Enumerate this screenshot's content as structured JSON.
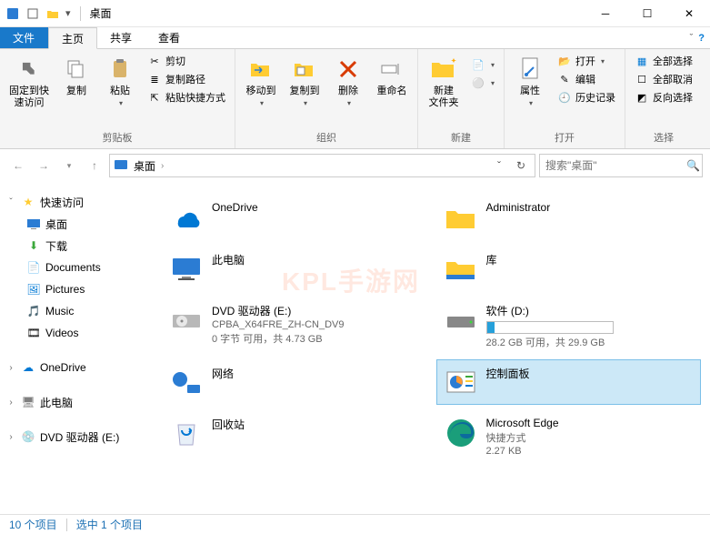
{
  "titlebar": {
    "title": "桌面"
  },
  "tabs": {
    "file": "文件",
    "home": "主页",
    "share": "共享",
    "view": "查看"
  },
  "ribbon": {
    "clipboard": {
      "pin": "固定到快\n速访问",
      "copy": "复制",
      "paste": "粘贴",
      "cut": "剪切",
      "copy_path": "复制路径",
      "paste_shortcut": "粘贴快捷方式",
      "group": "剪贴板"
    },
    "organize": {
      "move": "移动到",
      "copy_to": "复制到",
      "delete": "删除",
      "rename": "重命名",
      "group": "组织"
    },
    "new": {
      "new_folder": "新建\n文件夹",
      "group": "新建"
    },
    "open": {
      "properties": "属性",
      "open": "打开",
      "edit": "编辑",
      "history": "历史记录",
      "group": "打开"
    },
    "select": {
      "all": "全部选择",
      "none": "全部取消",
      "invert": "反向选择",
      "group": "选择"
    }
  },
  "addr": {
    "location": "桌面"
  },
  "search": {
    "placeholder": "搜索\"桌面\""
  },
  "sidebar": {
    "quick": "快速访问",
    "items": [
      {
        "label": "桌面"
      },
      {
        "label": "下载"
      },
      {
        "label": "Documents"
      },
      {
        "label": "Pictures"
      },
      {
        "label": "Music"
      },
      {
        "label": "Videos"
      }
    ],
    "onedrive": "OneDrive",
    "thispc": "此电脑",
    "dvd": "DVD 驱动器 (E:)"
  },
  "items": {
    "onedrive": {
      "name": "OneDrive"
    },
    "admin": {
      "name": "Administrator"
    },
    "thispc": {
      "name": "此电脑"
    },
    "libraries": {
      "name": "库"
    },
    "dvd": {
      "name": "DVD 驱动器 (E:)",
      "sub1": "CPBA_X64FRE_ZH-CN_DV9",
      "sub2": "0 字节 可用，共 4.73 GB"
    },
    "software_d": {
      "name": "软件 (D:)",
      "sub": "28.2 GB 可用，共 29.9 GB",
      "fill_pct": 6
    },
    "network": {
      "name": "网络"
    },
    "control_panel": {
      "name": "控制面板"
    },
    "recycle": {
      "name": "回收站"
    },
    "edge": {
      "name": "Microsoft Edge",
      "sub1": "快捷方式",
      "sub2": "2.27 KB"
    }
  },
  "status": {
    "count": "10 个项目",
    "selected": "选中 1 个项目"
  },
  "watermark": "KPL手游网"
}
